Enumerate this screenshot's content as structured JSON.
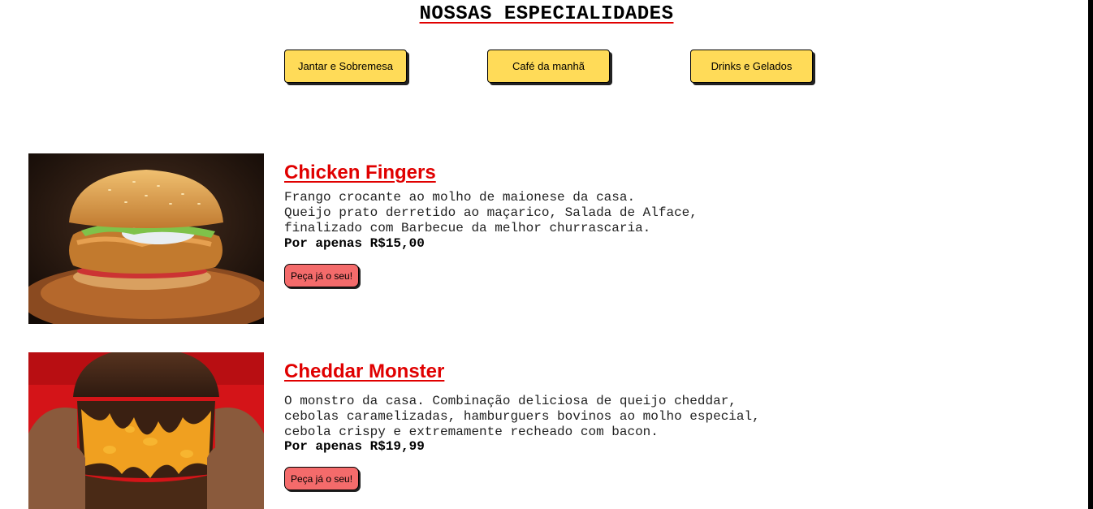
{
  "header": {
    "title": "NOSSAS ESPECIALIDADES"
  },
  "categories": [
    {
      "label": "Jantar e Sobremesa"
    },
    {
      "label": "Café da manhã"
    },
    {
      "label": "Drinks e Gelados"
    }
  ],
  "items": [
    {
      "title": "Chicken Fingers",
      "description": "Frango crocante ao molho de maionese da casa.\nQueijo prato derretido ao maçarico, Salada de Alface,\nfinalizado com Barbecue da melhor churrascaria.",
      "price": "Por apenas R$15,00",
      "order_label": "Peça já o seu!"
    },
    {
      "title": "Cheddar Monster",
      "description": "O monstro da casa. Combinação deliciosa de queijo cheddar,\ncebolas caramelizadas, hamburguers bovinos ao molho especial,\ncebola crispy e extremamente recheado com bacon.",
      "price": "Por apenas R$19,99",
      "order_label": "Peça já o seu!"
    }
  ],
  "colors": {
    "accent_red": "#e00000",
    "category_button": "#ffdb58",
    "order_button": "#f46b6b"
  }
}
